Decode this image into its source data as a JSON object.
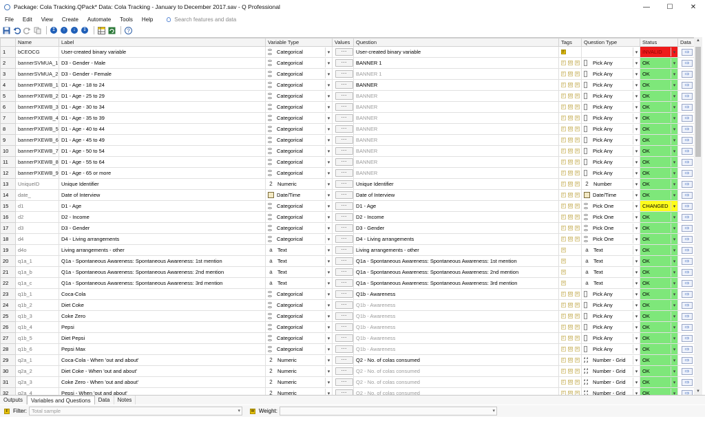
{
  "window": {
    "title": "Package: Cola Tracking.QPack*  Data: Cola Tracking - January to December 2017.sav - Q Professional",
    "minimize": "—",
    "maximize": "☐",
    "close": "✕"
  },
  "menu": {
    "items": [
      "File",
      "Edit",
      "View",
      "Create",
      "Automate",
      "Tools",
      "Help"
    ],
    "search_placeholder": "Search features and data"
  },
  "toolbar": {
    "icons": [
      "save-icon",
      "undo-icon",
      "redo-icon",
      "copy-icon",
      "nav-up-icon",
      "nav-up-alt-icon",
      "nav-down-icon",
      "nav-down-alt-icon",
      "table-icon",
      "refresh-icon",
      "help-icon"
    ]
  },
  "grid": {
    "headers": [
      "Name",
      "Label",
      "Variable Type",
      "Values",
      "Question",
      "Tags",
      "Question Type",
      "Status",
      "Data"
    ],
    "values_label": "···",
    "data_label": "⇨",
    "rows": [
      {
        "n": "1",
        "name": "bCEOCG",
        "label": "User-created binary variable",
        "vtype": "Categorical",
        "vicon": "cat",
        "question": "User-created binary variable",
        "qgray": false,
        "tags": "F",
        "qtype": "",
        "qicon": "",
        "status": "INVALID",
        "scolor": "invalid",
        "ngray": false
      },
      {
        "n": "2",
        "name": "bannerSVMUA_1",
        "label": "D3 - Gender - Male",
        "vtype": "Categorical",
        "vicon": "cat",
        "question": "BANNER 1",
        "qgray": false,
        "tags": "FWH",
        "qtype": "Pick Any",
        "qicon": "any",
        "status": "OK",
        "scolor": "ok",
        "ngray": false
      },
      {
        "n": "3",
        "name": "bannerSVMUA_2",
        "label": "D3 - Gender - Female",
        "vtype": "Categorical",
        "vicon": "cat",
        "question": "BANNER 1",
        "qgray": true,
        "tags": "FWH",
        "qtype": "Pick Any",
        "qicon": "any",
        "status": "OK",
        "scolor": "ok",
        "ngray": false
      },
      {
        "n": "4",
        "name": "bannerPXEWB_1",
        "label": "D1 - Age - 18 to 24",
        "vtype": "Categorical",
        "vicon": "cat",
        "question": "BANNER",
        "qgray": false,
        "tags": "FWH",
        "qtype": "Pick Any",
        "qicon": "any",
        "status": "OK",
        "scolor": "ok",
        "ngray": false
      },
      {
        "n": "5",
        "name": "bannerPXEWB_2",
        "label": "D1 - Age - 25 to 29",
        "vtype": "Categorical",
        "vicon": "cat",
        "question": "BANNER",
        "qgray": true,
        "tags": "FWH",
        "qtype": "Pick Any",
        "qicon": "any",
        "status": "OK",
        "scolor": "ok",
        "ngray": false
      },
      {
        "n": "6",
        "name": "bannerPXEWB_3",
        "label": "D1 - Age - 30 to 34",
        "vtype": "Categorical",
        "vicon": "cat",
        "question": "BANNER",
        "qgray": true,
        "tags": "FWH",
        "qtype": "Pick Any",
        "qicon": "any",
        "status": "OK",
        "scolor": "ok",
        "ngray": false
      },
      {
        "n": "7",
        "name": "bannerPXEWB_4",
        "label": "D1 - Age - 35 to 39",
        "vtype": "Categorical",
        "vicon": "cat",
        "question": "BANNER",
        "qgray": true,
        "tags": "FWH",
        "qtype": "Pick Any",
        "qicon": "any",
        "status": "OK",
        "scolor": "ok",
        "ngray": false
      },
      {
        "n": "8",
        "name": "bannerPXEWB_5",
        "label": "D1 - Age - 40 to 44",
        "vtype": "Categorical",
        "vicon": "cat",
        "question": "BANNER",
        "qgray": true,
        "tags": "FWH",
        "qtype": "Pick Any",
        "qicon": "any",
        "status": "OK",
        "scolor": "ok",
        "ngray": false
      },
      {
        "n": "9",
        "name": "bannerPXEWB_6",
        "label": "D1 - Age - 45 to 49",
        "vtype": "Categorical",
        "vicon": "cat",
        "question": "BANNER",
        "qgray": true,
        "tags": "FWH",
        "qtype": "Pick Any",
        "qicon": "any",
        "status": "OK",
        "scolor": "ok",
        "ngray": false
      },
      {
        "n": "10",
        "name": "bannerPXEWB_7",
        "label": "D1 - Age - 50 to 54",
        "vtype": "Categorical",
        "vicon": "cat",
        "question": "BANNER",
        "qgray": true,
        "tags": "FWH",
        "qtype": "Pick Any",
        "qicon": "any",
        "status": "OK",
        "scolor": "ok",
        "ngray": false
      },
      {
        "n": "11",
        "name": "bannerPXEWB_8",
        "label": "D1 - Age - 55 to 64",
        "vtype": "Categorical",
        "vicon": "cat",
        "question": "BANNER",
        "qgray": true,
        "tags": "FWH",
        "qtype": "Pick Any",
        "qicon": "any",
        "status": "OK",
        "scolor": "ok",
        "ngray": false
      },
      {
        "n": "12",
        "name": "bannerPXEWB_9",
        "label": "D1 - Age - 65 or more",
        "vtype": "Categorical",
        "vicon": "cat",
        "question": "BANNER",
        "qgray": true,
        "tags": "FWH",
        "qtype": "Pick Any",
        "qicon": "any",
        "status": "OK",
        "scolor": "ok",
        "ngray": false
      },
      {
        "n": "13",
        "name": "UniqueID",
        "label": "Unique Identifier",
        "vtype": "Numeric",
        "vicon": "num",
        "question": "Unique Identifier",
        "qgray": false,
        "tags": "FWH",
        "qtype": "Number",
        "qicon": "num",
        "status": "OK",
        "scolor": "ok",
        "ngray": true
      },
      {
        "n": "14",
        "name": "date_",
        "label": "Date of Interview",
        "vtype": "Date/Time",
        "vicon": "date",
        "question": "Date of Interview",
        "qgray": false,
        "tags": "FWH",
        "qtype": "Date/Time",
        "qicon": "date",
        "status": "OK",
        "scolor": "ok",
        "ngray": true
      },
      {
        "n": "15",
        "name": "d1",
        "label": "D1 - Age",
        "vtype": "Categorical",
        "vicon": "cat",
        "question": "D1 - Age",
        "qgray": false,
        "tags": "FWH",
        "qtype": "Pick One",
        "qicon": "one",
        "status": "CHANGED",
        "scolor": "changed",
        "ngray": true
      },
      {
        "n": "16",
        "name": "d2",
        "label": "D2 - Income",
        "vtype": "Categorical",
        "vicon": "cat",
        "question": "D2 - Income",
        "qgray": false,
        "tags": "FWH",
        "qtype": "Pick One",
        "qicon": "one",
        "status": "OK",
        "scolor": "ok",
        "ngray": true
      },
      {
        "n": "17",
        "name": "d3",
        "label": "D3 - Gender",
        "vtype": "Categorical",
        "vicon": "cat",
        "question": "D3 - Gender",
        "qgray": false,
        "tags": "FWH",
        "qtype": "Pick One",
        "qicon": "one",
        "status": "OK",
        "scolor": "ok",
        "ngray": true
      },
      {
        "n": "18",
        "name": "d4",
        "label": "D4 - Living arrangements",
        "vtype": "Categorical",
        "vicon": "cat",
        "question": "D4 - Living arrangements",
        "qgray": false,
        "tags": "FWH",
        "qtype": "Pick One",
        "qicon": "one",
        "status": "OK",
        "scolor": "ok",
        "ngray": true
      },
      {
        "n": "19",
        "name": "d4o",
        "label": "Living arrangements - other",
        "vtype": "Text",
        "vicon": "text",
        "question": "Living arrangements - other",
        "qgray": false,
        "tags": "H",
        "qtype": "Text",
        "qicon": "text",
        "status": "OK",
        "scolor": "ok",
        "ngray": true
      },
      {
        "n": "20",
        "name": "q1a_1",
        "label": "Q1a - Spontaneous Awareness: Spontaneous Awareness: 1st mention",
        "vtype": "Text",
        "vicon": "text",
        "question": "Q1a - Spontaneous Awareness: Spontaneous Awareness: 1st mention",
        "qgray": false,
        "tags": "H",
        "qtype": "Text",
        "qicon": "text",
        "status": "OK",
        "scolor": "ok",
        "ngray": true
      },
      {
        "n": "21",
        "name": "q1a_b",
        "label": "Q1a - Spontaneous Awareness: Spontaneous Awareness: 2nd mention",
        "vtype": "Text",
        "vicon": "text",
        "question": "Q1a - Spontaneous Awareness: Spontaneous Awareness: 2nd mention",
        "qgray": false,
        "tags": "H",
        "qtype": "Text",
        "qicon": "text",
        "status": "OK",
        "scolor": "ok",
        "ngray": true
      },
      {
        "n": "22",
        "name": "q1a_c",
        "label": "Q1a - Spontaneous Awareness: Spontaneous Awareness: 3rd mention",
        "vtype": "Text",
        "vicon": "text",
        "question": "Q1a - Spontaneous Awareness: Spontaneous Awareness: 3rd mention",
        "qgray": false,
        "tags": "H",
        "qtype": "Text",
        "qicon": "text",
        "status": "OK",
        "scolor": "ok",
        "ngray": true
      },
      {
        "n": "23",
        "name": "q1b_1",
        "label": "Coca-Cola",
        "vtype": "Categorical",
        "vicon": "cat",
        "question": "Q1b - Awareness",
        "qgray": false,
        "tags": "FWH",
        "qtype": "Pick Any",
        "qicon": "any",
        "status": "OK",
        "scolor": "ok",
        "ngray": true
      },
      {
        "n": "24",
        "name": "q1b_2",
        "label": "Diet Coke",
        "vtype": "Categorical",
        "vicon": "cat",
        "question": "Q1b - Awareness",
        "qgray": true,
        "tags": "FWH",
        "qtype": "Pick Any",
        "qicon": "any",
        "status": "OK",
        "scolor": "ok",
        "ngray": true
      },
      {
        "n": "25",
        "name": "q1b_3",
        "label": "Coke Zero",
        "vtype": "Categorical",
        "vicon": "cat",
        "question": "Q1b - Awareness",
        "qgray": true,
        "tags": "FWH",
        "qtype": "Pick Any",
        "qicon": "any",
        "status": "OK",
        "scolor": "ok",
        "ngray": true
      },
      {
        "n": "26",
        "name": "q1b_4",
        "label": "Pepsi",
        "vtype": "Categorical",
        "vicon": "cat",
        "question": "Q1b - Awareness",
        "qgray": true,
        "tags": "FWH",
        "qtype": "Pick Any",
        "qicon": "any",
        "status": "OK",
        "scolor": "ok",
        "ngray": true
      },
      {
        "n": "27",
        "name": "q1b_5",
        "label": "Diet Pepsi",
        "vtype": "Categorical",
        "vicon": "cat",
        "question": "Q1b - Awareness",
        "qgray": true,
        "tags": "FWH",
        "qtype": "Pick Any",
        "qicon": "any",
        "status": "OK",
        "scolor": "ok",
        "ngray": true
      },
      {
        "n": "28",
        "name": "q1b_6",
        "label": "Pepsi Max",
        "vtype": "Categorical",
        "vicon": "cat",
        "question": "Q1b - Awareness",
        "qgray": true,
        "tags": "FWH",
        "qtype": "Pick Any",
        "qicon": "any",
        "status": "OK",
        "scolor": "ok",
        "ngray": true
      },
      {
        "n": "29",
        "name": "q2a_1",
        "label": "Coca-Cola - When 'out and about'",
        "vtype": "Numeric",
        "vicon": "num",
        "question": "Q2 - No. of colas consumed",
        "qgray": false,
        "tags": "FWH",
        "qtype": "Number - Grid",
        "qicon": "grid",
        "status": "OK",
        "scolor": "ok",
        "ngray": true
      },
      {
        "n": "30",
        "name": "q2a_2",
        "label": "Diet Coke - When 'out and about'",
        "vtype": "Numeric",
        "vicon": "num",
        "question": "Q2 - No. of colas consumed",
        "qgray": true,
        "tags": "FWH",
        "qtype": "Number - Grid",
        "qicon": "grid",
        "status": "OK",
        "scolor": "ok",
        "ngray": true
      },
      {
        "n": "31",
        "name": "q2a_3",
        "label": "Coke Zero - When 'out and about'",
        "vtype": "Numeric",
        "vicon": "num",
        "question": "Q2 - No. of colas consumed",
        "qgray": true,
        "tags": "FWH",
        "qtype": "Number - Grid",
        "qicon": "grid",
        "status": "OK",
        "scolor": "ok",
        "ngray": true
      },
      {
        "n": "32",
        "name": "q2a_4",
        "label": "Pepsi - When 'out and about'",
        "vtype": "Numeric",
        "vicon": "num",
        "question": "Q2 - No. of colas consumed",
        "qgray": true,
        "tags": "FWH",
        "qtype": "Number - Grid",
        "qicon": "grid",
        "status": "OK",
        "scolor": "ok",
        "ngray": true
      }
    ]
  },
  "tabs": [
    "Outputs",
    "Variables and Questions",
    "Data",
    "Notes"
  ],
  "active_tab": "Variables and Questions",
  "filter": {
    "label": "Filter:",
    "value": "Total sample"
  },
  "weight": {
    "label": "Weight:",
    "value": ""
  },
  "colors": {
    "ok": "#7ee77a",
    "invalid": "#ee1b1b",
    "changed": "#fffc1c",
    "accent": "#1f5fb8"
  }
}
